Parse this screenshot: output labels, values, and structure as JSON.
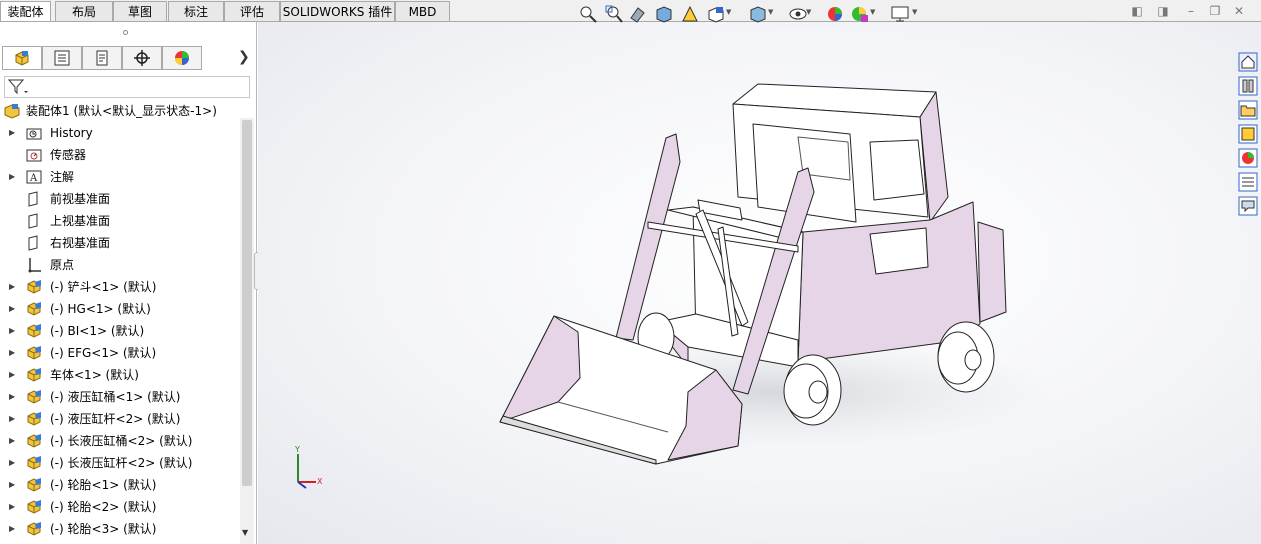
{
  "command_tabs": [
    "装配体",
    "布局",
    "草图",
    "标注",
    "评估",
    "SOLIDWORKS 插件",
    "MBD"
  ],
  "active_tab": "装配体",
  "manager_tabs": [
    "feature-manager-icon",
    "property-manager-icon",
    "configuration-manager-icon",
    "dimxpert-icon",
    "display-manager-icon"
  ],
  "root": {
    "label": "装配体1  (默认<默认_显示状态-1>)"
  },
  "tree": [
    {
      "label": "History",
      "icon": "history-folder-icon",
      "expandable": true
    },
    {
      "label": "传感器",
      "icon": "sensor-icon",
      "expandable": false
    },
    {
      "label": "注解",
      "icon": "annotation-icon",
      "expandable": true
    },
    {
      "label": "前视基准面",
      "icon": "plane-icon",
      "expandable": false
    },
    {
      "label": "上视基准面",
      "icon": "plane-icon",
      "expandable": false
    },
    {
      "label": "右视基准面",
      "icon": "plane-icon",
      "expandable": false
    },
    {
      "label": "原点",
      "icon": "origin-icon",
      "expandable": false
    },
    {
      "label": "(-) 铲斗<1> (默认)",
      "icon": "part-icon",
      "expandable": true
    },
    {
      "label": "(-) HG<1> (默认)",
      "icon": "part-icon",
      "expandable": true
    },
    {
      "label": "(-) BI<1> (默认)",
      "icon": "part-icon",
      "expandable": true
    },
    {
      "label": "(-) EFG<1> (默认)",
      "icon": "part-icon",
      "expandable": true
    },
    {
      "label": "车体<1> (默认)",
      "icon": "part-icon",
      "expandable": true
    },
    {
      "label": "(-) 液压缸桶<1> (默认)",
      "icon": "part-icon",
      "expandable": true
    },
    {
      "label": "(-) 液压缸杆<2> (默认)",
      "icon": "part-icon",
      "expandable": true
    },
    {
      "label": "(-) 长液压缸桶<2> (默认)",
      "icon": "part-icon",
      "expandable": true
    },
    {
      "label": "(-) 长液压缸杆<2> (默认)",
      "icon": "part-icon",
      "expandable": true
    },
    {
      "label": "(-) 轮胎<1> (默认)",
      "icon": "part-icon",
      "expandable": true
    },
    {
      "label": "(-) 轮胎<2> (默认)",
      "icon": "part-icon",
      "expandable": true
    },
    {
      "label": "(-) 轮胎<3> (默认)",
      "icon": "part-icon",
      "expandable": true
    }
  ],
  "headsup_toolbar": [
    "zoom-to-fit-icon",
    "zoom-to-area-icon",
    "previous-view-icon",
    "section-view-icon",
    "dynamic-annotation-icon",
    "view-orientation-icon",
    "display-style-icon",
    "hide-show-items-icon",
    "edit-appearance-icon",
    "apply-scene-icon",
    "view-settings-icon"
  ],
  "task_pane": [
    "home-icon",
    "design-library-icon",
    "file-explorer-icon",
    "view-palette-icon",
    "appearances-icon",
    "custom-properties-icon",
    "forum-icon"
  ],
  "triad_labels": {
    "x": "X",
    "y": "Y"
  },
  "colors": {
    "model_pink": "#e6d5e6",
    "edge": "#222222",
    "tab_border": "#a9a9a9"
  }
}
